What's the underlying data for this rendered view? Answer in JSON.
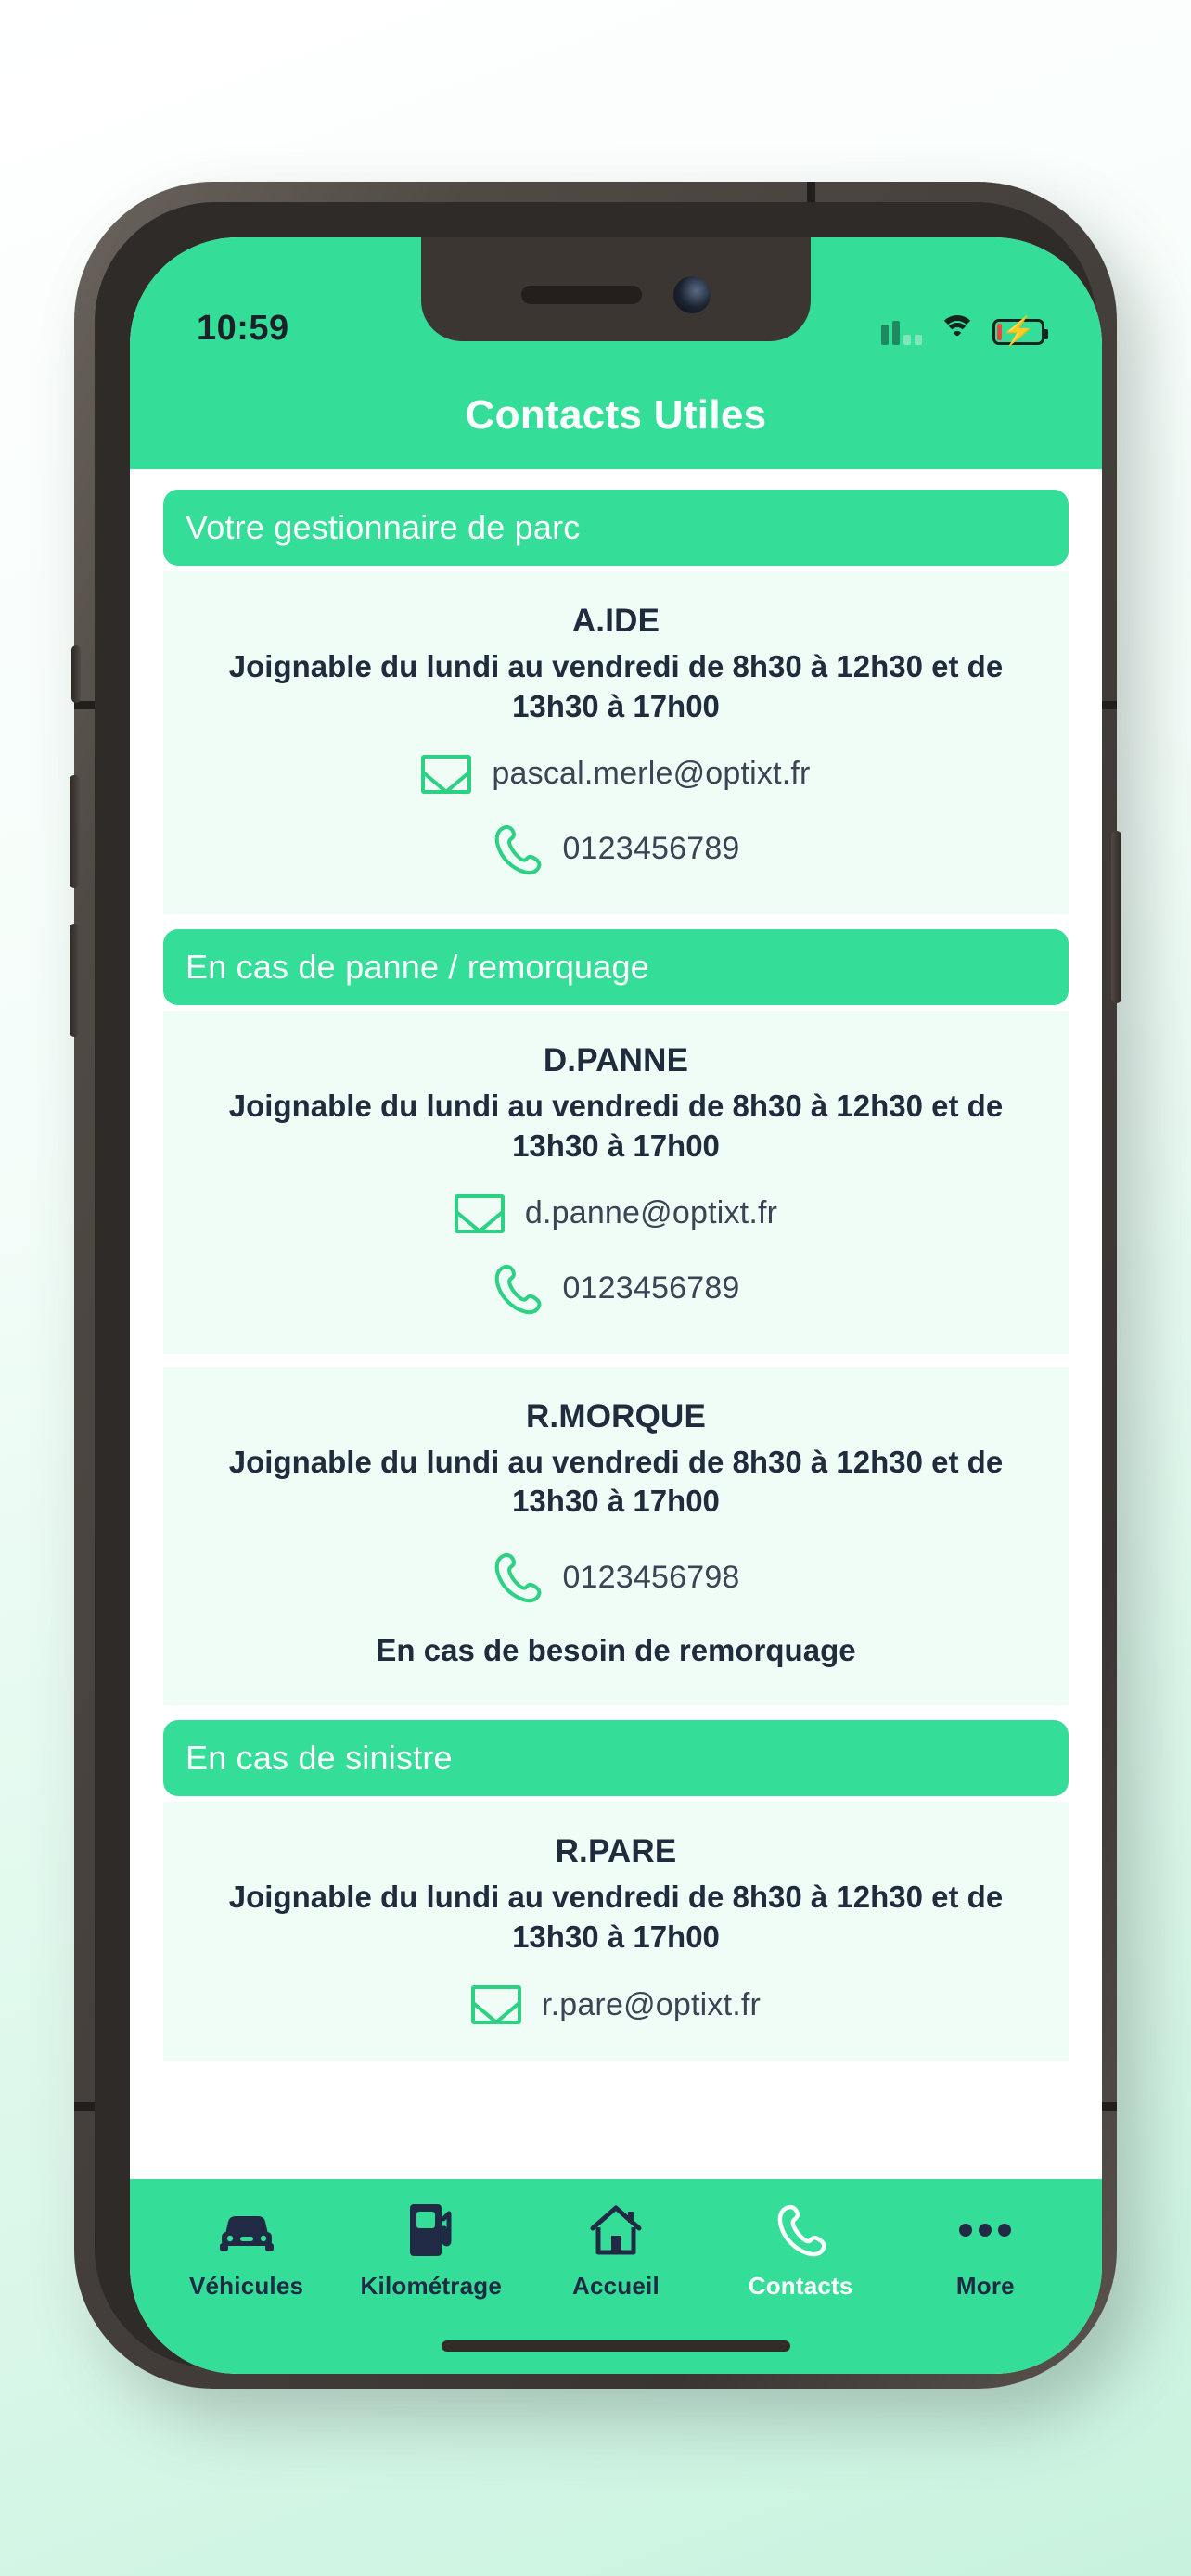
{
  "status_bar": {
    "time": "10:59",
    "signal_icon": "signal-bars-icon",
    "wifi_icon": "wifi-icon",
    "battery_icon": "battery-charging-icon"
  },
  "header": {
    "title": "Contacts Utiles"
  },
  "colors": {
    "accent_green": "#34dd98",
    "card_bg": "#effdf6",
    "text_dark": "#212b3e",
    "icon_green": "#2dd184",
    "tab_inactive": "#202a44",
    "tab_active": "#ffffff"
  },
  "sections": [
    {
      "header": "Votre gestionnaire de parc",
      "cards": [
        {
          "name": "A.IDE",
          "hours": "Joignable du lundi au vendredi de 8h30 à 12h30 et de 13h30 à 17h00",
          "email": "pascal.merle@optixt.fr",
          "phone": "0123456789",
          "note": ""
        }
      ]
    },
    {
      "header": "En cas de panne / remorquage",
      "cards": [
        {
          "name": "D.PANNE",
          "hours": "Joignable du lundi au vendredi de 8h30 à 12h30 et de 13h30 à 17h00",
          "email": "d.panne@optixt.fr",
          "phone": "0123456789",
          "note": ""
        },
        {
          "name": "R.MORQUE",
          "hours": "Joignable du lundi au vendredi de 8h30 à 12h30 et de 13h30 à 17h00",
          "email": "",
          "phone": "0123456798",
          "note": "En cas de besoin de remorquage"
        }
      ]
    },
    {
      "header": "En cas de sinistre",
      "cards": [
        {
          "name": "R.PARE",
          "hours": "Joignable du lundi au vendredi de 8h30 à 12h30 et de 13h30 à 17h00",
          "email": "r.pare@optixt.fr",
          "phone": "",
          "note": ""
        }
      ]
    }
  ],
  "tabs": [
    {
      "label": "Véhicules",
      "icon": "car-icon",
      "active": false
    },
    {
      "label": "Kilométrage",
      "icon": "fuel-pump-icon",
      "active": false
    },
    {
      "label": "Accueil",
      "icon": "home-icon",
      "active": false
    },
    {
      "label": "Contacts",
      "icon": "phone-icon",
      "active": true
    },
    {
      "label": "More",
      "icon": "ellipsis-icon",
      "active": false
    }
  ]
}
